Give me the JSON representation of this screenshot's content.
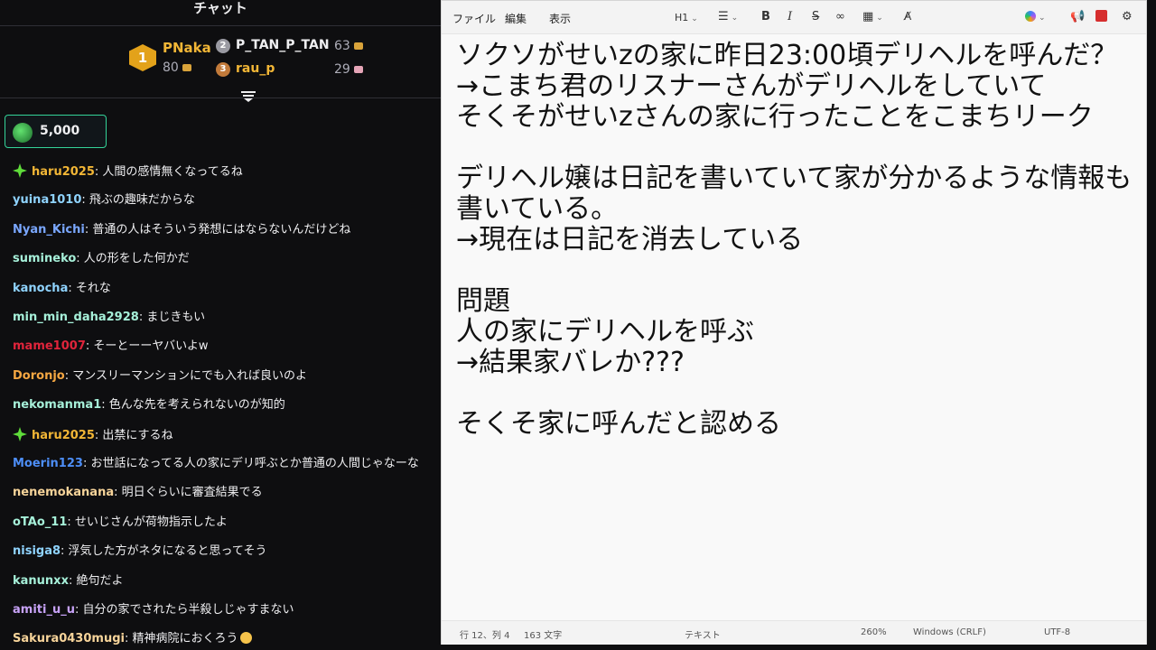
{
  "chat": {
    "title": "チャット",
    "leaderboard": {
      "first": {
        "rank": "1",
        "name": "PNaka",
        "points": "80"
      },
      "second": {
        "rank": "2",
        "name": "P_TAN_P_TAN",
        "points": "63"
      },
      "third": {
        "rank": "3",
        "name": "rau_p",
        "points": "29"
      }
    },
    "pinned": {
      "amount": "5,000"
    },
    "messages": [
      {
        "user": "haru2025",
        "color": "#f2b636",
        "text": ": 人間の感情無くなってるね",
        "sparkle": true
      },
      {
        "user": "yuina1010",
        "color": "#8fd3fe",
        "text": ": 飛ぶの趣味だからな"
      },
      {
        "user": "Nyan_Kichi",
        "color": "#7aa7ff",
        "text": ": 普通の人はそういう発想にはならないんだけどね"
      },
      {
        "user": "sumineko",
        "color": "#a6f0d9",
        "text": ": 人の形をした何かだ"
      },
      {
        "user": "kanocha",
        "color": "#8fd3fe",
        "text": ": それな"
      },
      {
        "user": "min_min_daha2928",
        "color": "#a6f0d9",
        "text": ": まじきもい"
      },
      {
        "user": "mame1007",
        "color": "#e0243b",
        "text": ": そーとーーヤバいよw"
      },
      {
        "user": "Doronjo",
        "color": "#f5a742",
        "text": ": マンスリーマンションにでも入れば良いのよ"
      },
      {
        "user": "nekomanma1",
        "color": "#a6f0d9",
        "text": ": 色んな先を考えられないのが知的"
      },
      {
        "user": "haru2025",
        "color": "#f2b636",
        "text": ": 出禁にするね",
        "sparkle": true
      },
      {
        "user": "Moerin123",
        "color": "#4d8ef7",
        "text": ": お世話になってる人の家にデリ呼ぶとか普通の人間じゃなーな"
      },
      {
        "user": "nenemokanana",
        "color": "#f7d49a",
        "text": ": 明日ぐらいに審査結果でる"
      },
      {
        "user": "oTAo_11",
        "color": "#a6f0d9",
        "text": ": せいじさんが荷物指示したよ"
      },
      {
        "user": "nisiga8",
        "color": "#8fd3fe",
        "text": ": 浮気した方がネタになると思ってそう"
      },
      {
        "user": "kanunxx",
        "color": "#a6f0d9",
        "text": ": 絶句だよ"
      },
      {
        "user": "amiti_u_u",
        "color": "#c7a2f7",
        "text": ": 自分の家でされたら半殺しじゃすまない"
      },
      {
        "user": "Sakura0430mugi",
        "color": "#f7d49a",
        "text": ": 精神病院におくろう",
        "emoji": true
      }
    ]
  },
  "notepad": {
    "menu": {
      "file": "ファイル",
      "edit": "編集",
      "view": "表示"
    },
    "toolbar": {
      "heading": "H1",
      "bold": "B",
      "italic": "I",
      "strike": "S"
    },
    "content": "ソクソがせいzの家に昨日23:00頃デリヘルを呼んだ？\n→こまち君のリスナーさんがデリヘルをしていて\nそくそがせいzさんの家に行ったことをこまちリーク\n\nデリヘル嬢は日記を書いていて家が分かるような情報も書いている。\n→現在は日記を消去している\n\n問題\n人の家にデリヘルを呼ぶ\n→結果家バレか???\n\nそくそ家に呼んだと認める",
    "status": {
      "position": "行 12、列 4",
      "chars": "163 文字",
      "format": "テキスト",
      "zoom": "260%",
      "line_ending": "Windows (CRLF)",
      "encoding": "UTF-8"
    }
  }
}
